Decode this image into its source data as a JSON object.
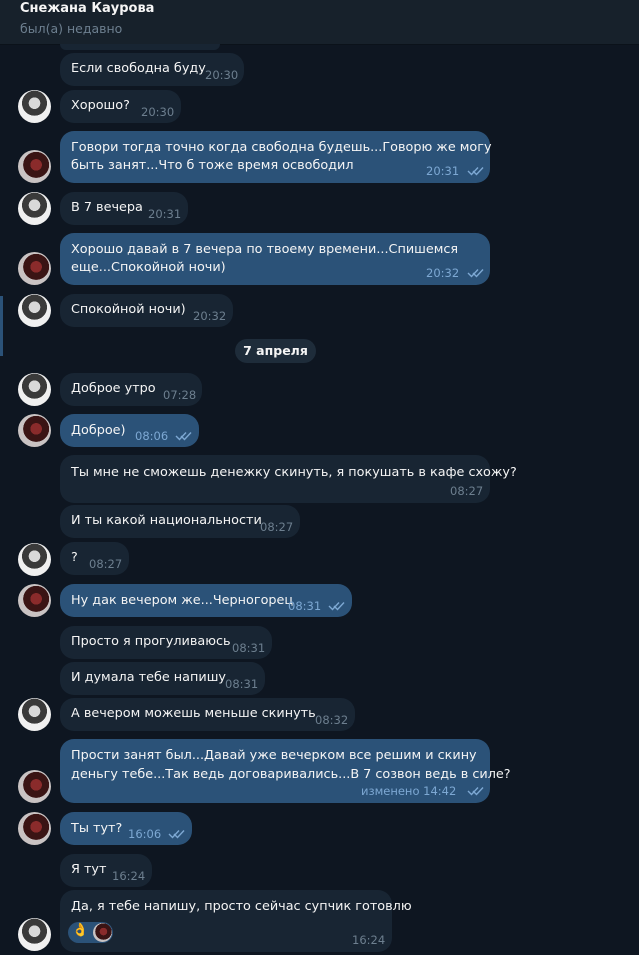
{
  "header": {
    "name": "Снежана Каурова",
    "status": "был(а) недавно"
  },
  "date_separator": "7 апреля",
  "messages": [
    {
      "text": "Если свободна буду",
      "time": "20:30"
    },
    {
      "text": "Хорошо?",
      "time": "20:30"
    },
    {
      "text": [
        "Говори тогда точно когда свободна будешь...Говорю же могу",
        "быть занят...Что б тоже время освободил"
      ],
      "time": "20:31"
    },
    {
      "text": "В 7 вечера",
      "time": "20:31"
    },
    {
      "text": [
        "Хорошо давай в 7 вечера по твоему времени...Спишемся",
        "еще...Спокойной ночи)"
      ],
      "time": "20:32"
    },
    {
      "text": "Спокойной ночи)",
      "time": "20:32"
    },
    {
      "text": "Доброе утро",
      "time": "07:28"
    },
    {
      "text": "Доброе)",
      "time": "08:06"
    },
    {
      "text": "Ты мне не сможешь денежку скинуть, я покушать в кафе схожу?",
      "time": "08:27"
    },
    {
      "text": "И ты какой национальности",
      "time": "08:27"
    },
    {
      "text": "?",
      "time": "08:27"
    },
    {
      "text": "Ну дак вечером же...Черногорец",
      "time": "08:31"
    },
    {
      "text": "Просто я прогуливаюсь",
      "time": "08:31"
    },
    {
      "text": "И думала тебе напишу",
      "time": "08:31"
    },
    {
      "text": "А вечером можешь меньше скинуть",
      "time": "08:32"
    },
    {
      "text": [
        "Прости занят был...Давай уже вечерком все решим и скину",
        "деньгу тебе...Так ведь договаривались...В 7 созвон ведь в силе?"
      ],
      "time": "изменено 14:42"
    },
    {
      "text": "Ты тут?",
      "time": "16:06"
    },
    {
      "text": "Я тут",
      "time": "16:24"
    },
    {
      "text": "Да, я тебе напишу, просто сейчас супчик готовлю",
      "time": "16:24",
      "reaction": "👌"
    }
  ],
  "colors": {
    "background": "#0e1621",
    "incoming": "#182533",
    "outgoing": "#2b5278",
    "accent": "#7da8d3"
  }
}
